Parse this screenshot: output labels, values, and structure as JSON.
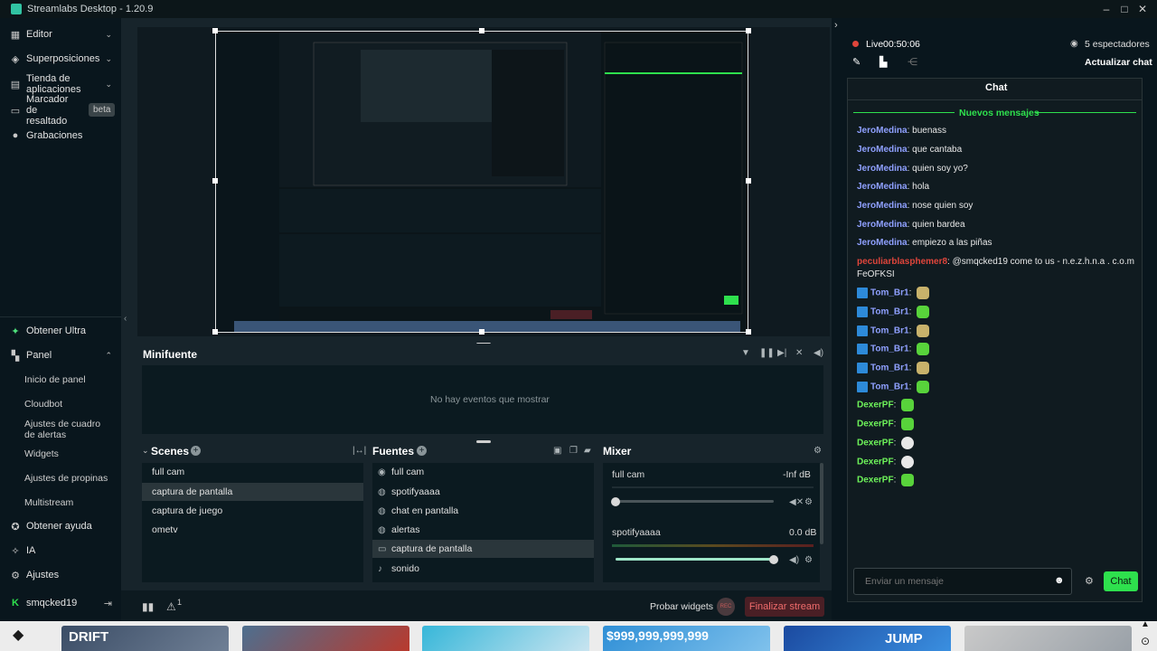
{
  "window": {
    "title": "Streamlabs Desktop - 1.20.9"
  },
  "sidebar": {
    "top_items": [
      {
        "label": "Editor",
        "icon": "editor-icon"
      },
      {
        "label": "Superposiciones",
        "icon": "overlays-icon"
      },
      {
        "label": "Tienda de aplicaciones",
        "icon": "app-store-icon"
      },
      {
        "label": "Marcador de resaltado",
        "icon": "highlighter-icon",
        "badge": "beta"
      },
      {
        "label": "Grabaciones",
        "icon": "recordings-icon"
      }
    ],
    "obtain_ultra": "Obtener Ultra",
    "panel_label": "Panel",
    "panel_subitems": [
      "Inicio de panel",
      "Cloudbot",
      "Ajustes de cuadro de alertas",
      "Widgets",
      "Ajustes de propinas",
      "Multistream"
    ],
    "help": "Obtener ayuda",
    "ai": "IA",
    "settings": "Ajustes",
    "user": "smqcked19"
  },
  "minifuente": {
    "title": "Minifuente",
    "empty_message": "No hay eventos que mostrar"
  },
  "scenes": {
    "title": "Scenes",
    "items": [
      "full cam",
      "captura de pantalla",
      "captura de juego",
      "ometv"
    ],
    "selected_index": 1
  },
  "sources": {
    "title": "Fuentes",
    "items": [
      {
        "label": "full cam",
        "icon": "camera-icon"
      },
      {
        "label": "spotifyaaaa",
        "icon": "globe-icon"
      },
      {
        "label": "chat en pantalla",
        "icon": "globe-icon"
      },
      {
        "label": "alertas",
        "icon": "globe-icon"
      },
      {
        "label": "captura de pantalla",
        "icon": "monitor-icon"
      },
      {
        "label": "sonido",
        "icon": "microphone-icon"
      }
    ],
    "selected_index": 4
  },
  "mixer": {
    "title": "Mixer",
    "channels": [
      {
        "name": "full cam",
        "level": "-Inf dB",
        "volume": 0.0
      },
      {
        "name": "spotifyaaaa",
        "level": "0.0 dB",
        "volume": 1.0
      }
    ]
  },
  "bottom": {
    "alert_count": "1",
    "test_widgets": "Probar widgets",
    "rec": "REC",
    "end_stream": "Finalizar stream"
  },
  "live": {
    "status": "Live",
    "time": "00:50:06",
    "viewers": "5 espectadores",
    "refresh_chat": "Actualizar chat"
  },
  "chat": {
    "title": "Chat",
    "new_messages": "Nuevos mensajes",
    "messages": [
      {
        "user": "JeroMedina",
        "text": ": buenass"
      },
      {
        "user": "JeroMedina",
        "text": ": que cantaba"
      },
      {
        "user": "JeroMedina",
        "text": ": quien soy yo?"
      },
      {
        "user": "JeroMedina",
        "text": ": hola"
      },
      {
        "user": "JeroMedina",
        "text": ": nose quien soy"
      },
      {
        "user": "JeroMedina",
        "text": ": quien bardea"
      },
      {
        "user": "JeroMedina",
        "text": ": empiezo a las piñas"
      },
      {
        "user": "peculiarblasphemer8",
        "text": ": @smqcked19 come to us - n.e.z.h.n.a . c.o.m",
        "text2": "FeOFKSI"
      },
      {
        "user": "Tom_Br1",
        "text": ":"
      },
      {
        "user": "Tom_Br1",
        "text": ":"
      },
      {
        "user": "Tom_Br1",
        "text": ":"
      },
      {
        "user": "Tom_Br1",
        "text": ":"
      },
      {
        "user": "Tom_Br1",
        "text": ":"
      },
      {
        "user": "Tom_Br1",
        "text": ":"
      },
      {
        "user": "DexerPF",
        "text": ":"
      },
      {
        "user": "DexerPF",
        "text": ":"
      },
      {
        "user": "DexerPF",
        "text": ":"
      },
      {
        "user": "DexerPF",
        "text": ":"
      },
      {
        "user": "DexerPF",
        "text": ":"
      }
    ],
    "input_placeholder": "Enviar un mensaje",
    "send": "Chat"
  },
  "taskbar": {
    "thumbnails": [
      "DRIFT",
      "",
      "",
      "$999,999,999,999",
      "JUMP",
      ""
    ]
  },
  "colors": {
    "accent_green": "#2ee04d",
    "live_red": "#e0453b",
    "nick_blue": "#8fa0ff",
    "nick_green": "#6ef35a"
  }
}
